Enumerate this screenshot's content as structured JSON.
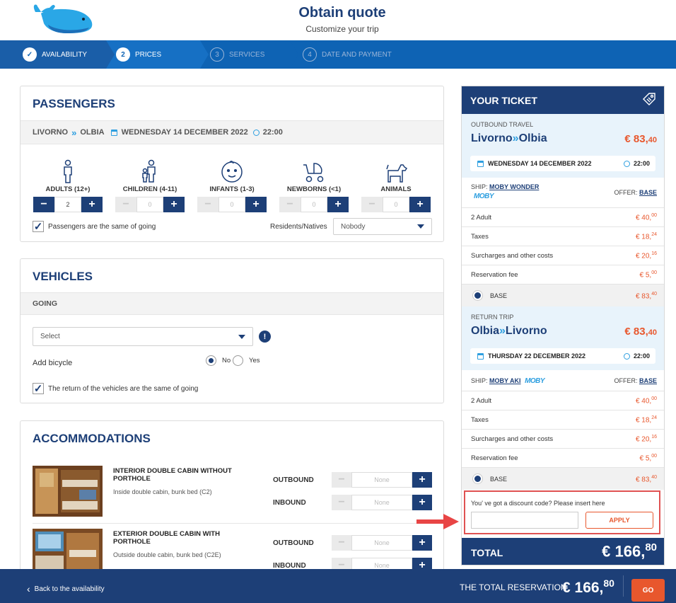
{
  "header": {
    "title": "Obtain quote",
    "subtitle": "Customize your trip"
  },
  "steps": [
    {
      "num": "✓",
      "label": "AVAILABILITY",
      "state": "done"
    },
    {
      "num": "2",
      "label": "PRICES",
      "state": "active"
    },
    {
      "num": "3",
      "label": "SERVICES",
      "state": "todo"
    },
    {
      "num": "4",
      "label": "DATE AND PAYMENT",
      "state": "todo"
    }
  ],
  "passengers": {
    "title": "PASSENGERS",
    "route_from": "LIVORNO",
    "route_to": "OLBIA",
    "date": "WEDNESDAY 14 DECEMBER 2022",
    "time": "22:00",
    "types": [
      {
        "label": "ADULTS (12+)",
        "value": "2",
        "icon": "adult-icon"
      },
      {
        "label": "CHILDREN (4-11)",
        "value": "0",
        "icon": "child-icon"
      },
      {
        "label": "INFANTS (1-3)",
        "value": "0",
        "icon": "infant-icon"
      },
      {
        "label": "NEWBORNS (<1)",
        "value": "0",
        "icon": "stroller-icon"
      },
      {
        "label": "ANIMALS",
        "value": "0",
        "icon": "dog-icon"
      }
    ],
    "same_label": "Passengers are the same of going",
    "residents_label": "Residents/Natives",
    "residents_value": "Nobody"
  },
  "vehicles": {
    "title": "VEHICLES",
    "going_label": "GOING",
    "select_value": "Select",
    "bicycle_label": "Add bicycle",
    "no_label": "No",
    "yes_label": "Yes",
    "same_label": "The return of the vehicles are the same of going"
  },
  "accommodations": {
    "title": "ACCOMMODATIONS",
    "items": [
      {
        "name": "INTERIOR DOUBLE CABIN WITHOUT PORTHOLE",
        "desc": "Inside double cabin, bunk bed (C2)",
        "outbound": "None",
        "inbound": "None"
      },
      {
        "name": "EXTERIOR DOUBLE CABIN WITH PORTHOLE",
        "desc": "Outside double cabin, bunk bed (C2E)",
        "outbound": "None",
        "inbound": "None"
      }
    ],
    "outbound_label": "OUTBOUND",
    "inbound_label": "INBOUND"
  },
  "ticket": {
    "title": "YOUR TICKET",
    "outbound": {
      "label": "OUTBOUND TRAVEL",
      "from": "Livorno",
      "to": "Olbia",
      "price_main": "€ 83,",
      "price_dec": "40",
      "date": "WEDNESDAY 14 DECEMBER 2022",
      "time": "22:00",
      "ship_label": "SHIP:",
      "ship": "MOBY WONDER",
      "brand": "MOBY",
      "offer_label": "OFFER:",
      "offer": "BASE",
      "rows": [
        {
          "label": "2 Adult",
          "amt": "€ 40,",
          "dec": "00"
        },
        {
          "label": "Taxes",
          "amt": "€ 18,",
          "dec": "24"
        },
        {
          "label": "Surcharges and other costs",
          "amt": "€ 20,",
          "dec": "16"
        },
        {
          "label": "Reservation fee",
          "amt": "€ 5,",
          "dec": "00"
        }
      ],
      "base_label": "BASE",
      "base_amt": "€ 83,",
      "base_dec": "40"
    },
    "return": {
      "label": "RETURN TRIP",
      "from": "Olbia",
      "to": "Livorno",
      "price_main": "€ 83,",
      "price_dec": "40",
      "date": "THURSDAY 22 DECEMBER 2022",
      "time": "22:00",
      "ship_label": "SHIP:",
      "ship": "MOBY AKI",
      "brand": "MOBY",
      "offer_label": "OFFER:",
      "offer": "BASE",
      "rows": [
        {
          "label": "2 Adult",
          "amt": "€ 40,",
          "dec": "00"
        },
        {
          "label": "Taxes",
          "amt": "€ 18,",
          "dec": "24"
        },
        {
          "label": "Surcharges and other costs",
          "amt": "€ 20,",
          "dec": "16"
        },
        {
          "label": "Reservation fee",
          "amt": "€ 5,",
          "dec": "00"
        }
      ],
      "base_label": "BASE",
      "base_amt": "€ 83,",
      "base_dec": "40"
    },
    "discount_label": "You' ve got a discount code? Please insert here",
    "discount_value": "",
    "apply_label": "APPLY",
    "total_label": "TOTAL",
    "total_main": "€ 166,",
    "total_dec": "80"
  },
  "footer": {
    "back_label": "Back to the availability",
    "total_label": "THE TOTAL RESERVATION",
    "total_main": "€ 166,",
    "total_dec": "80",
    "go_label": "GO"
  },
  "colors": {
    "navy": "#1d3f77",
    "blue": "#0e63b4",
    "accent": "#e8572d",
    "light": "#2e9fe0"
  }
}
